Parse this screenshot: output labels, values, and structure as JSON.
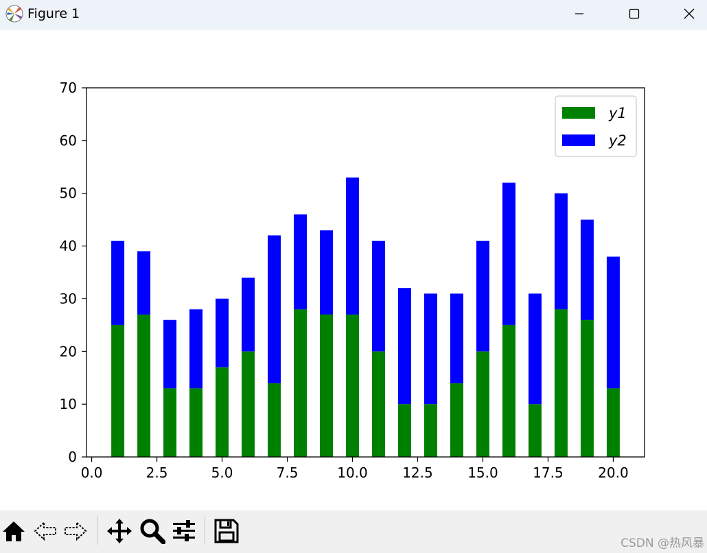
{
  "window": {
    "title": "Figure 1",
    "accent": "#eef2f9"
  },
  "chart_data": {
    "type": "bar",
    "stacked": true,
    "x": [
      1,
      2,
      3,
      4,
      5,
      6,
      7,
      8,
      9,
      10,
      11,
      12,
      13,
      14,
      15,
      16,
      17,
      18,
      19,
      20
    ],
    "series": [
      {
        "name": "y1",
        "color": "#008000",
        "values": [
          25,
          27,
          13,
          13,
          17,
          20,
          14,
          28,
          27,
          27,
          20,
          10,
          10,
          14,
          20,
          25,
          10,
          28,
          26,
          13
        ]
      },
      {
        "name": "y2",
        "color": "#0000ff",
        "values": [
          16,
          12,
          13,
          15,
          13,
          14,
          28,
          18,
          16,
          26,
          21,
          22,
          21,
          17,
          21,
          27,
          21,
          22,
          19,
          25
        ]
      }
    ],
    "bar_width": 0.5,
    "xlim": [
      -0.2,
      21.2
    ],
    "ylim": [
      0,
      70
    ],
    "xticks": [
      0.0,
      2.5,
      5.0,
      7.5,
      10.0,
      12.5,
      15.0,
      17.5,
      20.0
    ],
    "xtick_labels": [
      "0.0",
      "2.5",
      "5.0",
      "7.5",
      "10.0",
      "12.5",
      "15.0",
      "17.5",
      "20.0"
    ],
    "yticks": [
      0,
      10,
      20,
      30,
      40,
      50,
      60,
      70
    ],
    "ytick_labels": [
      "0",
      "10",
      "20",
      "30",
      "40",
      "50",
      "60",
      "70"
    ],
    "title": "",
    "xlabel": "",
    "ylabel": "",
    "legend": {
      "position": "top-right",
      "entries": [
        "y1",
        "y2"
      ]
    },
    "grid": false
  },
  "toolbar": {
    "items": [
      {
        "name": "home-icon"
      },
      {
        "name": "back-icon"
      },
      {
        "name": "forward-icon"
      },
      {
        "name": "pan-icon"
      },
      {
        "name": "zoom-icon"
      },
      {
        "name": "configure-subplots-icon"
      },
      {
        "name": "save-icon"
      }
    ]
  },
  "watermark": "CSDN @热风暴"
}
